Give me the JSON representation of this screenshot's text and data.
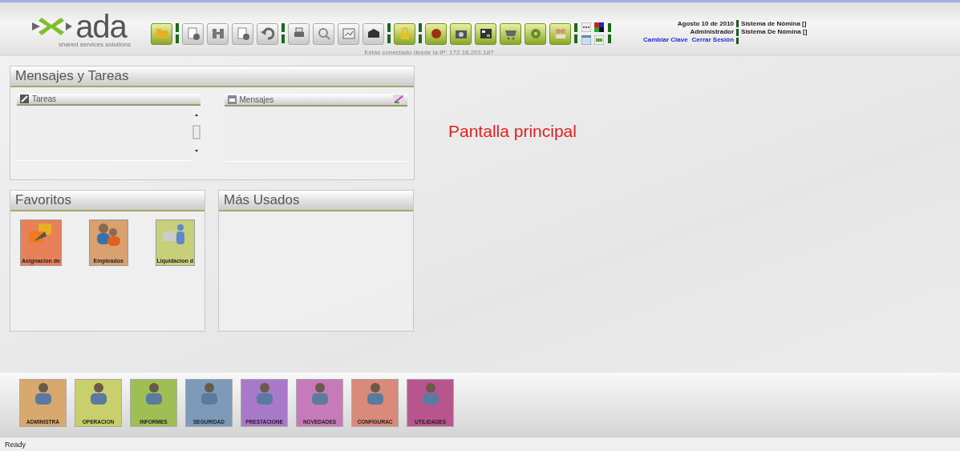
{
  "header": {
    "logo": "ada",
    "tagline": "shared services solutions",
    "connection": "Estas conectado desde la IP: 172.16.201.187",
    "date": "Agosto 10 de 2010",
    "user": "Administrador",
    "links": [
      "Cambiar Clave",
      "Cerrar Sesión"
    ],
    "systems": [
      "Sistema de Nómina []",
      "Sistema De Nómina []"
    ]
  },
  "toolbar": [
    {
      "kind": "accent"
    },
    {
      "kind": "separator"
    },
    {
      "kind": "plain"
    },
    {
      "kind": "plain"
    },
    {
      "kind": "plain"
    },
    {
      "kind": "plain"
    },
    {
      "kind": "separator"
    },
    {
      "kind": "plain"
    },
    {
      "kind": "plain"
    },
    {
      "kind": "plain"
    },
    {
      "kind": "plain"
    },
    {
      "kind": "separator"
    },
    {
      "kind": "accent"
    },
    {
      "kind": "separator"
    },
    {
      "kind": "accent"
    },
    {
      "kind": "accent"
    },
    {
      "kind": "accent"
    },
    {
      "kind": "accent"
    },
    {
      "kind": "accent"
    },
    {
      "kind": "accent"
    },
    {
      "kind": "separator"
    },
    {
      "kind": "mini"
    },
    {
      "kind": "separator"
    }
  ],
  "messages_panel": {
    "title": "Mensajes y Tareas",
    "tasks": {
      "title": "Tareas"
    },
    "messages": {
      "title": "Mensajes"
    }
  },
  "favorites": {
    "title": "Favoritos",
    "items": [
      {
        "label": "Asignacion de",
        "color": "#e8805a"
      },
      {
        "label": "Empleados",
        "color": "#d9a070"
      },
      {
        "label": "Liquidacion d",
        "color": "#c8cf7a"
      }
    ]
  },
  "most_used": {
    "title": "Más Usados"
  },
  "main_title": "Pantalla principal",
  "modules": [
    {
      "label": "ADMINISTRA",
      "color": "#d9a86e"
    },
    {
      "label": "OPERACION",
      "color": "#c9cf6a"
    },
    {
      "label": "INFORMES",
      "color": "#9fbf55"
    },
    {
      "label": "SEGURIDAD",
      "color": "#7d9ab8"
    },
    {
      "label": "PRESTACIONE",
      "color": "#a979c9"
    },
    {
      "label": "NOVEDADES",
      "color": "#c77ab9"
    },
    {
      "label": "CONFIGURAC",
      "color": "#d98a7a"
    },
    {
      "label": "UTILIDADES",
      "color": "#b8558f"
    }
  ],
  "status_bar": "Ready"
}
